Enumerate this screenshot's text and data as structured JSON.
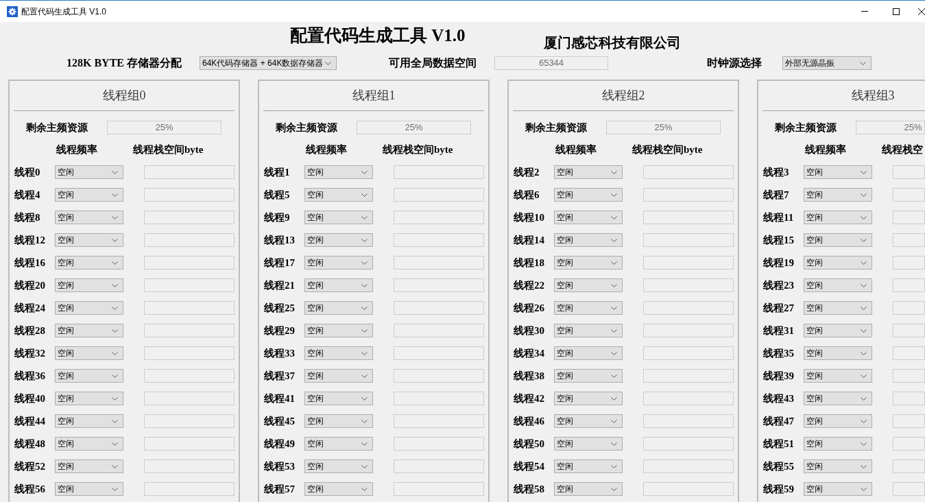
{
  "window": {
    "title": "配置代码生成工具 V1.0"
  },
  "header": {
    "title": "配置代码生成工具 V1.0",
    "company": "厦门感芯科技有限公司"
  },
  "settings": {
    "memory": {
      "label": "128K BYTE 存储器分配",
      "value": "64K代码存储器 + 64K数据存储器"
    },
    "global_space": {
      "label": "可用全局数据空间",
      "value": "65344",
      "disabled": true
    },
    "clock": {
      "label": "时钟源选择",
      "value": "外部无源晶振"
    }
  },
  "groups": [
    {
      "title": "线程组0",
      "remaining": {
        "label": "剩余主频资源",
        "value": "25%",
        "disabled": true
      },
      "columns": [
        "线程频率",
        "线程栈空间byte"
      ],
      "stack_disabled": true,
      "threads": [
        {
          "label": "线程0",
          "frequency": "空闲"
        },
        {
          "label": "线程4",
          "frequency": "空闲"
        },
        {
          "label": "线程8",
          "frequency": "空闲"
        },
        {
          "label": "线程12",
          "frequency": "空闲"
        },
        {
          "label": "线程16",
          "frequency": "空闲"
        },
        {
          "label": "线程20",
          "frequency": "空闲"
        },
        {
          "label": "线程24",
          "frequency": "空闲"
        },
        {
          "label": "线程28",
          "frequency": "空闲"
        },
        {
          "label": "线程32",
          "frequency": "空闲"
        },
        {
          "label": "线程36",
          "frequency": "空闲"
        },
        {
          "label": "线程40",
          "frequency": "空闲"
        },
        {
          "label": "线程44",
          "frequency": "空闲"
        },
        {
          "label": "线程48",
          "frequency": "空闲"
        },
        {
          "label": "线程52",
          "frequency": "空闲"
        },
        {
          "label": "线程56",
          "frequency": "空闲"
        }
      ]
    },
    {
      "title": "线程组1",
      "remaining": {
        "label": "剩余主频资源",
        "value": "25%",
        "disabled": true
      },
      "columns": [
        "线程频率",
        "线程栈空间byte"
      ],
      "stack_disabled": true,
      "threads": [
        {
          "label": "线程1",
          "frequency": "空闲"
        },
        {
          "label": "线程5",
          "frequency": "空闲"
        },
        {
          "label": "线程9",
          "frequency": "空闲"
        },
        {
          "label": "线程13",
          "frequency": "空闲"
        },
        {
          "label": "线程17",
          "frequency": "空闲"
        },
        {
          "label": "线程21",
          "frequency": "空闲"
        },
        {
          "label": "线程25",
          "frequency": "空闲"
        },
        {
          "label": "线程29",
          "frequency": "空闲"
        },
        {
          "label": "线程33",
          "frequency": "空闲"
        },
        {
          "label": "线程37",
          "frequency": "空闲"
        },
        {
          "label": "线程41",
          "frequency": "空闲"
        },
        {
          "label": "线程45",
          "frequency": "空闲"
        },
        {
          "label": "线程49",
          "frequency": "空闲"
        },
        {
          "label": "线程53",
          "frequency": "空闲"
        },
        {
          "label": "线程57",
          "frequency": "空闲"
        }
      ]
    },
    {
      "title": "线程组2",
      "remaining": {
        "label": "剩余主频资源",
        "value": "25%",
        "disabled": true
      },
      "columns": [
        "线程频率",
        "线程栈空间byte"
      ],
      "stack_disabled": true,
      "threads": [
        {
          "label": "线程2",
          "frequency": "空闲"
        },
        {
          "label": "线程6",
          "frequency": "空闲"
        },
        {
          "label": "线程10",
          "frequency": "空闲"
        },
        {
          "label": "线程14",
          "frequency": "空闲"
        },
        {
          "label": "线程18",
          "frequency": "空闲"
        },
        {
          "label": "线程22",
          "frequency": "空闲"
        },
        {
          "label": "线程26",
          "frequency": "空闲"
        },
        {
          "label": "线程30",
          "frequency": "空闲"
        },
        {
          "label": "线程34",
          "frequency": "空闲"
        },
        {
          "label": "线程38",
          "frequency": "空闲"
        },
        {
          "label": "线程42",
          "frequency": "空闲"
        },
        {
          "label": "线程46",
          "frequency": "空闲"
        },
        {
          "label": "线程50",
          "frequency": "空闲"
        },
        {
          "label": "线程54",
          "frequency": "空闲"
        },
        {
          "label": "线程58",
          "frequency": "空闲"
        }
      ]
    },
    {
      "title": "线程组3",
      "remaining": {
        "label": "剩余主频资源",
        "value": "25%",
        "disabled": true
      },
      "columns": [
        "线程频率",
        "线程栈空"
      ],
      "stack_disabled": true,
      "threads": [
        {
          "label": "线程3",
          "frequency": "空闲"
        },
        {
          "label": "线程7",
          "frequency": "空闲"
        },
        {
          "label": "线程11",
          "frequency": "空闲"
        },
        {
          "label": "线程15",
          "frequency": "空闲"
        },
        {
          "label": "线程19",
          "frequency": "空闲"
        },
        {
          "label": "线程23",
          "frequency": "空闲"
        },
        {
          "label": "线程27",
          "frequency": "空闲"
        },
        {
          "label": "线程31",
          "frequency": "空闲"
        },
        {
          "label": "线程35",
          "frequency": "空闲"
        },
        {
          "label": "线程39",
          "frequency": "空闲"
        },
        {
          "label": "线程43",
          "frequency": "空闲"
        },
        {
          "label": "线程47",
          "frequency": "空闲"
        },
        {
          "label": "线程51",
          "frequency": "空闲"
        },
        {
          "label": "线程55",
          "frequency": "空闲"
        },
        {
          "label": "线程59",
          "frequency": "空闲"
        }
      ]
    }
  ]
}
